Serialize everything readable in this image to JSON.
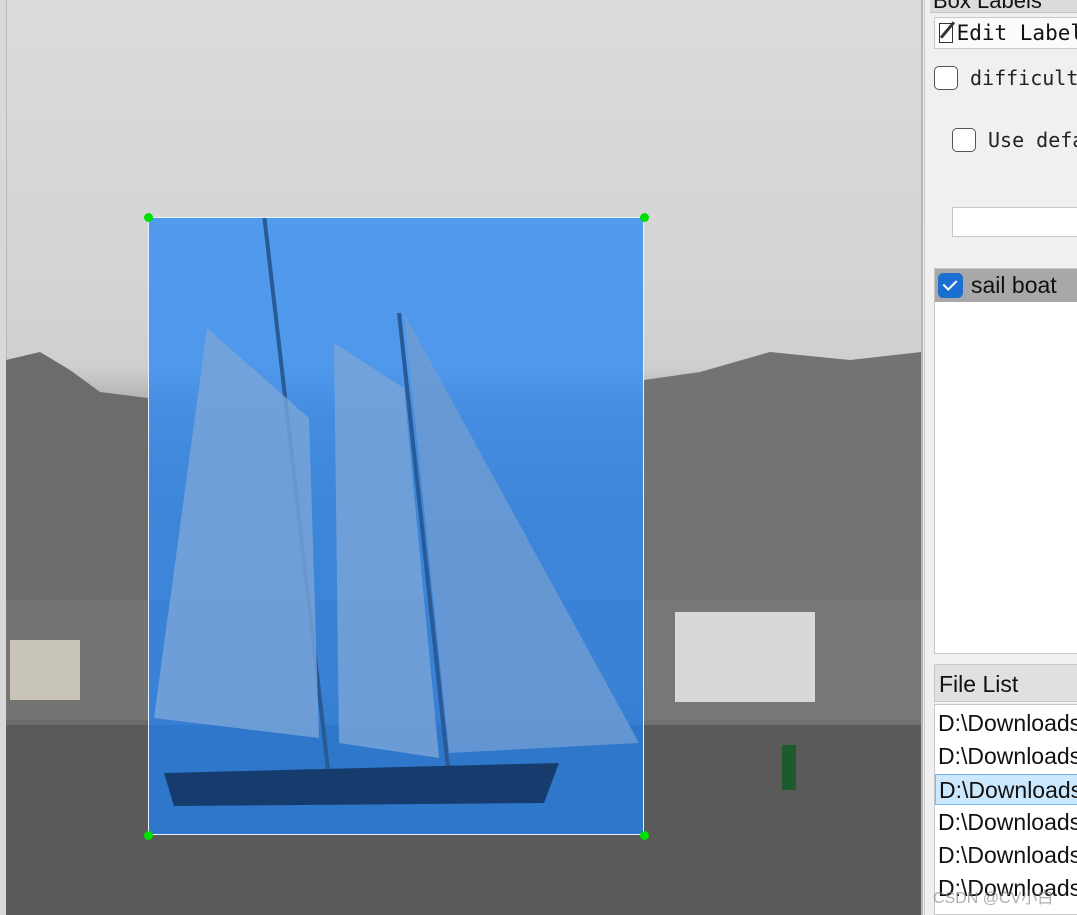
{
  "canvas": {
    "annotation_label": "sail boat"
  },
  "panel": {
    "dock_title": "Box Labels",
    "edit_label_button": "Edit Label",
    "difficult_label": "difficult",
    "use_default_label": "Use default label",
    "default_label_value": "",
    "labels": [
      {
        "text": "sail boat",
        "checked": true
      }
    ]
  },
  "file_list": {
    "title": "File List",
    "items": [
      "D:\\Downloads",
      "D:\\Downloads",
      "D:\\Downloads",
      "D:\\Downloads",
      "D:\\Downloads",
      "D:\\Downloads"
    ],
    "selected_index": 2
  },
  "watermark": "CSDN @CV小白",
  "colors": {
    "box_fill": "#1e82f5",
    "handle": "#00e000",
    "checkbox_checked": "#1a6fd0",
    "selected_row": "#cce8ff"
  }
}
